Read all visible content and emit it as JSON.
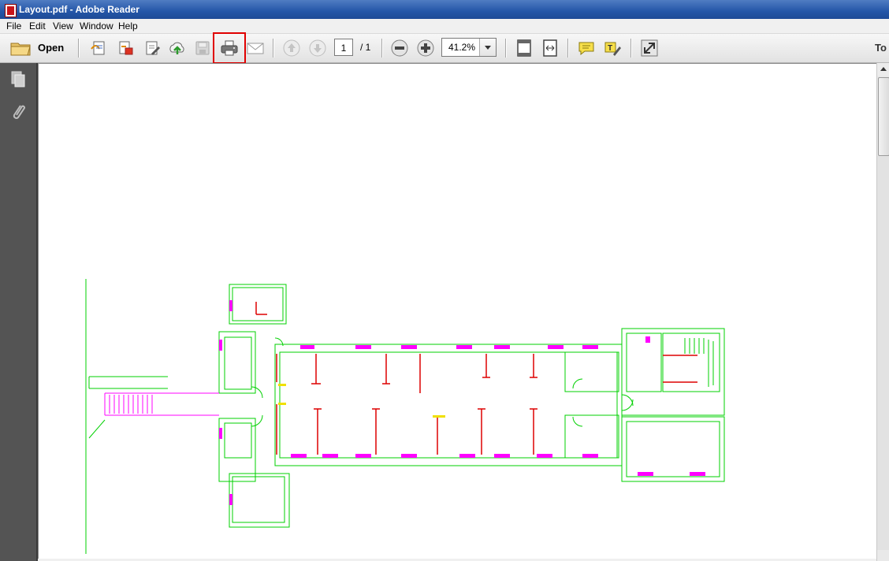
{
  "window": {
    "title": "Layout.pdf - Adobe Reader"
  },
  "menu": {
    "items": [
      {
        "label": "File"
      },
      {
        "label": "Edit"
      },
      {
        "label": "View"
      },
      {
        "label": "Window"
      },
      {
        "label": "Help"
      }
    ]
  },
  "toolbar": {
    "open_label": "Open",
    "page_current": "1",
    "page_total": "/ 1",
    "zoom": "41.2%",
    "tools_label": "To"
  },
  "highlight": {
    "color": "#e00000",
    "target": "print-button"
  },
  "colors": {
    "floorplan_green": "#00cc00",
    "floorplan_magenta": "#ff00ff",
    "floorplan_red": "#dd0000",
    "floorplan_yellow": "#ffff00"
  }
}
